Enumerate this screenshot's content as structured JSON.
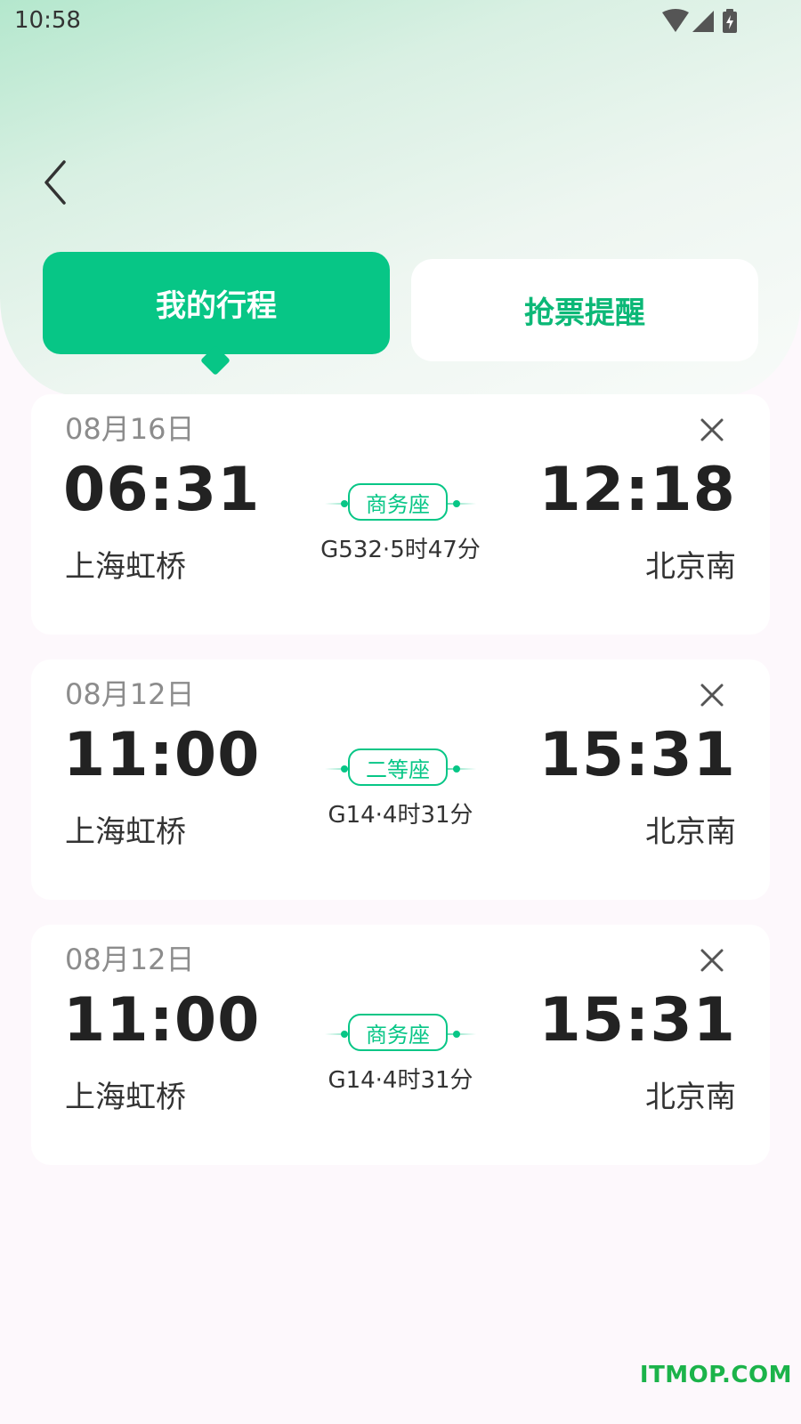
{
  "status_bar": {
    "time": "10:58",
    "icons": [
      "wifi-icon",
      "signal-icon",
      "battery-charging-icon"
    ]
  },
  "nav": {
    "back_icon": "chevron-left-icon"
  },
  "tabs": [
    {
      "label": "我的行程",
      "active": true
    },
    {
      "label": "抢票提醒",
      "active": false
    }
  ],
  "trips": [
    {
      "date": "08月16日",
      "depart_time": "06:31",
      "depart_station": "上海虹桥",
      "seat_class": "商务座",
      "train_info": "G532·5时47分",
      "arrive_time": "12:18",
      "arrive_station": "北京南"
    },
    {
      "date": "08月12日",
      "depart_time": "11:00",
      "depart_station": "上海虹桥",
      "seat_class": "二等座",
      "train_info": "G14·4时31分",
      "arrive_time": "15:31",
      "arrive_station": "北京南"
    },
    {
      "date": "08月12日",
      "depart_time": "11:00",
      "depart_station": "上海虹桥",
      "seat_class": "商务座",
      "train_info": "G14·4时31分",
      "arrive_time": "15:31",
      "arrive_station": "北京南"
    }
  ],
  "watermark": "ITMOP.COM",
  "colors": {
    "accent": "#07c686",
    "accent_text": "#0cb877",
    "background": "#fdf8fc",
    "watermark": "#1bb34a"
  }
}
